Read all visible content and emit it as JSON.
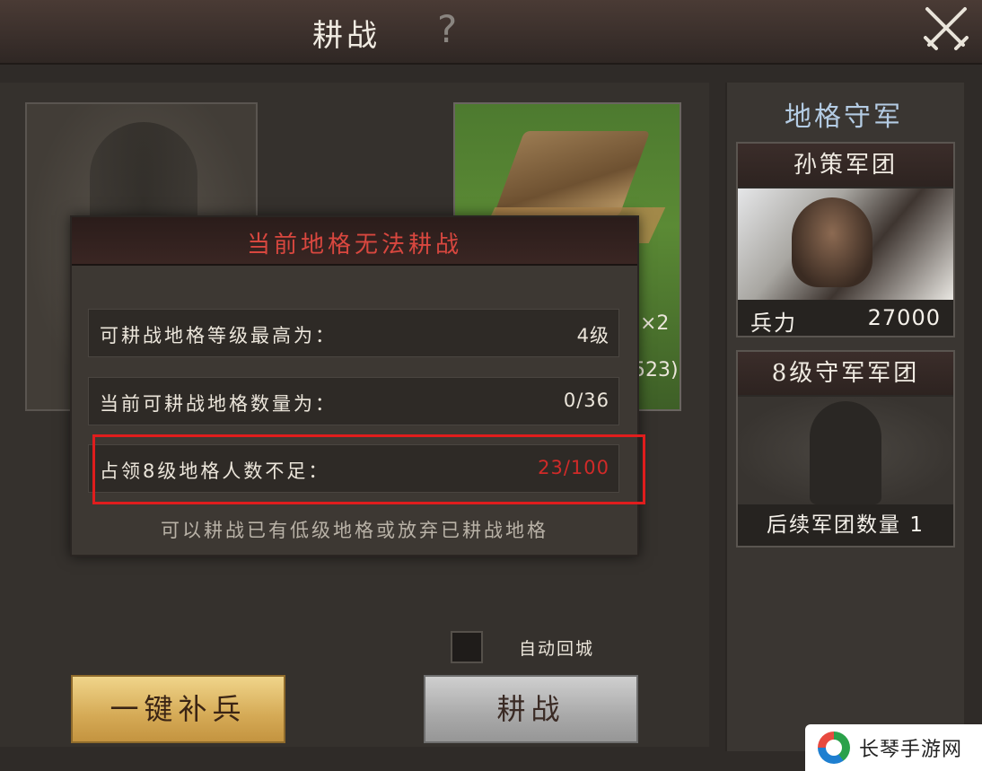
{
  "header": {
    "title": "耕战",
    "help_icon": "help-icon",
    "close_icon": "crossed-swords-close-icon"
  },
  "battle": {
    "reward_multiplier": "×2",
    "reward_partial": "523)"
  },
  "dialog": {
    "title": "当前地格无法耕战",
    "rows": [
      {
        "label": "可耕战地格等级最高为：",
        "value": "4级",
        "warning": false
      },
      {
        "label": "当前可耕战地格数量为：",
        "value": "0/36",
        "warning": false
      },
      {
        "label": "占领8级地格人数不足：",
        "value": "23/100",
        "warning": true
      }
    ],
    "hint": "可以耕战已有低级地格或放弃已耕战地格"
  },
  "options": {
    "auto_return_label": "自动回城",
    "auto_return_checked": false
  },
  "buttons": {
    "replenish": "一键补兵",
    "farm_battle": "耕战"
  },
  "side": {
    "title": "地格守军",
    "army1": {
      "name": "孙策军团",
      "troops_label": "兵力",
      "troops_value": "27000"
    },
    "army2": {
      "name": "8级守军军团",
      "followup": "后续军团数量 1"
    }
  },
  "watermark": {
    "text": "长琴手游网"
  },
  "colors": {
    "warning_red": "#d02a28",
    "highlight_red": "#e01d1d",
    "dialog_title": "#d8473f",
    "side_title": "#b4cce4",
    "gold_button": "#d5aa56"
  }
}
